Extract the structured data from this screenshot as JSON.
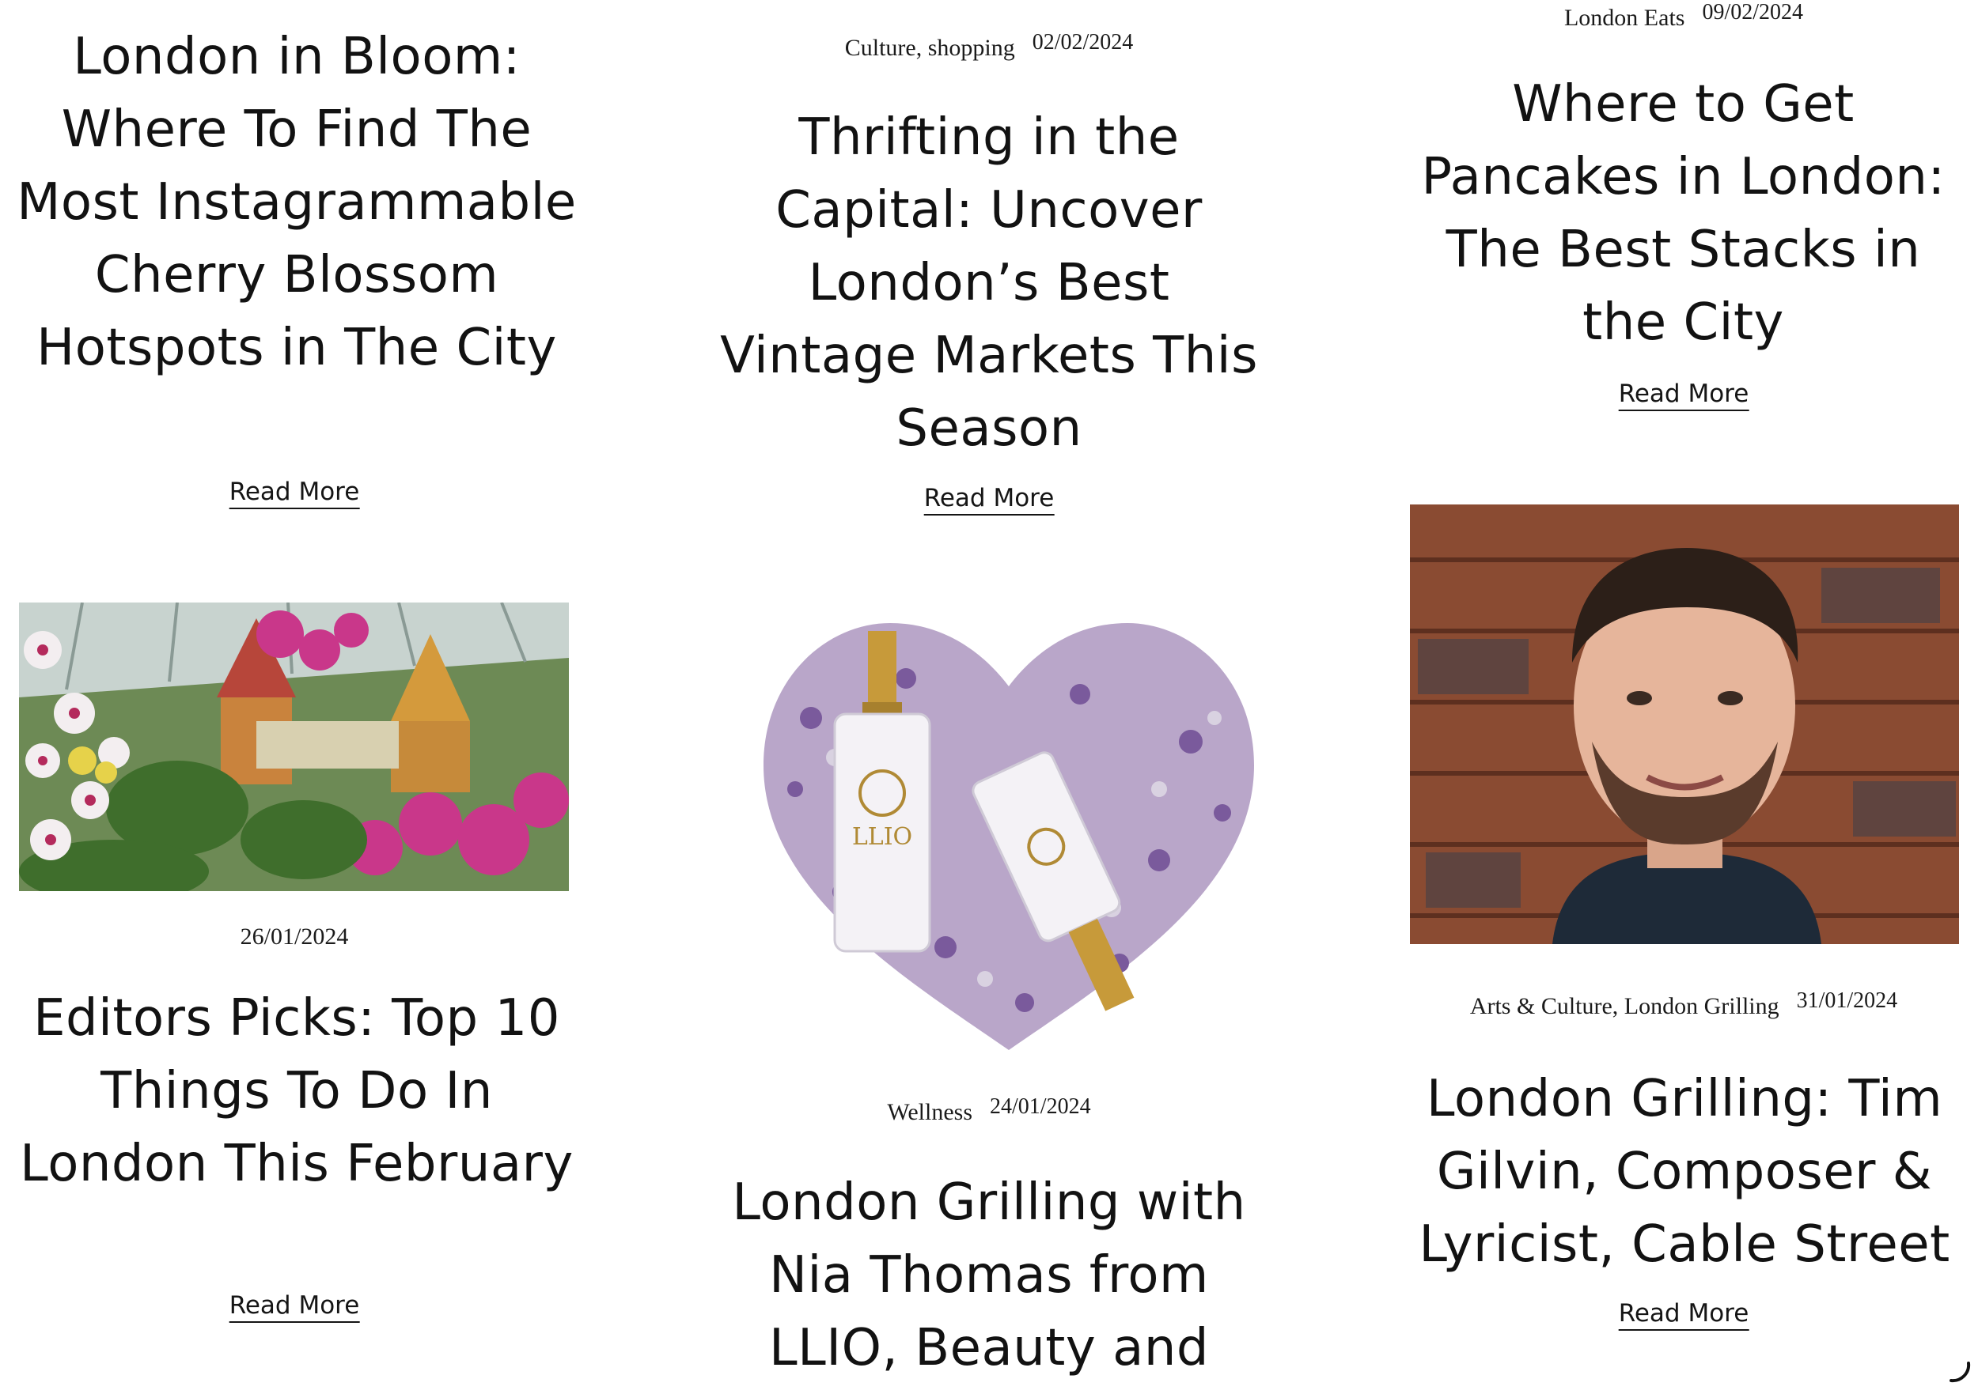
{
  "posts": {
    "bloom": {
      "title": "London in Bloom: Where To Find The Most Instagrammable Cherry Blossom Hotspots in The City",
      "read_more": "Read More"
    },
    "thrifting": {
      "category": "Culture, shopping",
      "date": "02/02/2024",
      "title": "Thrifting in the Capital: Uncover London’s Best Vintage Markets This Season",
      "read_more": "Read More"
    },
    "pancakes": {
      "category": "London Eats",
      "date": "09/02/2024",
      "title": "Where to Get Pancakes in London: The Best Stacks in the City",
      "read_more": "Read More"
    },
    "editors": {
      "date": "26/01/2024",
      "title": "Editors Picks: Top 10 Things To Do In London This February",
      "read_more": "Read More"
    },
    "nia": {
      "category": "Wellness",
      "date": "24/01/2024",
      "title": "London Grilling with Nia Thomas from LLIO, Beauty and",
      "image_brand": "LLIO"
    },
    "tim": {
      "category": "Arts & Culture, London Grilling",
      "date": "31/01/2024",
      "title": "London Grilling: Tim Gilvin, Composer & Lyricist, Cable Street",
      "read_more": "Read More"
    }
  },
  "icons": {
    "loading": "loading-spinner-icon"
  }
}
